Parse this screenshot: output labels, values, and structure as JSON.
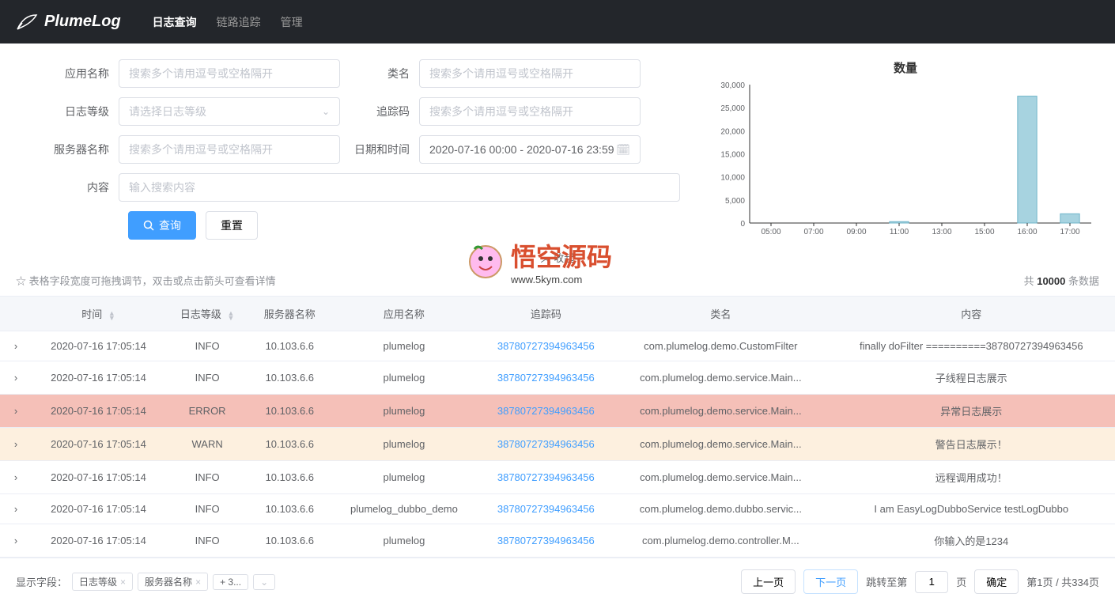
{
  "header": {
    "brand": "PlumeLog",
    "nav": [
      {
        "label": "日志查询",
        "active": true
      },
      {
        "label": "链路追踪",
        "active": false
      },
      {
        "label": "管理",
        "active": false
      }
    ]
  },
  "form": {
    "appName": {
      "label": "应用名称",
      "placeholder": "搜索多个请用逗号或空格隔开"
    },
    "className": {
      "label": "类名",
      "placeholder": "搜索多个请用逗号或空格隔开"
    },
    "logLevel": {
      "label": "日志等级",
      "placeholder": "请选择日志等级"
    },
    "traceId": {
      "label": "追踪码",
      "placeholder": "搜索多个请用逗号或空格隔开"
    },
    "serverName": {
      "label": "服务器名称",
      "placeholder": "搜索多个请用逗号或空格隔开"
    },
    "dateTime": {
      "label": "日期和时间",
      "value": "2020-07-16 00:00 - 2020-07-16 23:59"
    },
    "content": {
      "label": "内容",
      "placeholder": "输入搜索内容"
    },
    "searchBtn": "查询",
    "resetBtn": "重置"
  },
  "chart": {
    "title": "数量"
  },
  "chart_data": {
    "type": "bar",
    "title": "数量",
    "xlabel": "",
    "ylabel": "",
    "ylim": [
      0,
      30000
    ],
    "categories": [
      "05:00",
      "07:00",
      "09:00",
      "11:00",
      "13:00",
      "15:00",
      "16:00",
      "17:00"
    ],
    "values": [
      0,
      0,
      0,
      300,
      0,
      0,
      27500,
      2000
    ]
  },
  "collapse": "收起",
  "tip": "表格字段宽度可拖拽调节，双击或点击箭头可查看详情",
  "total": {
    "prefix": "共 ",
    "count": "10000",
    "suffix": " 条数据"
  },
  "columns": [
    "时间",
    "日志等级",
    "服务器名称",
    "应用名称",
    "追踪码",
    "类名",
    "内容"
  ],
  "rows": [
    {
      "time": "2020-07-16 17:05:14",
      "level": "INFO",
      "server": "10.103.6.6",
      "app": "plumelog",
      "trace": "38780727394963456",
      "class": "com.plumelog.demo.CustomFilter",
      "content": "finally doFilter ==========38780727394963456",
      "cls": ""
    },
    {
      "time": "2020-07-16 17:05:14",
      "level": "INFO",
      "server": "10.103.6.6",
      "app": "plumelog",
      "trace": "38780727394963456",
      "class": "com.plumelog.demo.service.Main...",
      "content": "子线程日志展示",
      "cls": ""
    },
    {
      "time": "2020-07-16 17:05:14",
      "level": "ERROR",
      "server": "10.103.6.6",
      "app": "plumelog",
      "trace": "38780727394963456",
      "class": "com.plumelog.demo.service.Main...",
      "content": "异常日志展示",
      "cls": "error"
    },
    {
      "time": "2020-07-16 17:05:14",
      "level": "WARN",
      "server": "10.103.6.6",
      "app": "plumelog",
      "trace": "38780727394963456",
      "class": "com.plumelog.demo.service.Main...",
      "content": "警告日志展示！",
      "cls": "warn"
    },
    {
      "time": "2020-07-16 17:05:14",
      "level": "INFO",
      "server": "10.103.6.6",
      "app": "plumelog",
      "trace": "38780727394963456",
      "class": "com.plumelog.demo.service.Main...",
      "content": "远程调用成功！",
      "cls": ""
    },
    {
      "time": "2020-07-16 17:05:14",
      "level": "INFO",
      "server": "10.103.6.6",
      "app": "plumelog_dubbo_demo",
      "trace": "38780727394963456",
      "class": "com.plumelog.demo.dubbo.servic...",
      "content": "I am EasyLogDubboService testLogDubbo",
      "cls": ""
    },
    {
      "time": "2020-07-16 17:05:14",
      "level": "INFO",
      "server": "10.103.6.6",
      "app": "plumelog",
      "trace": "38780727394963456",
      "class": "com.plumelog.demo.controller.M...",
      "content": "你输入的是1234",
      "cls": ""
    }
  ],
  "footer": {
    "fieldsLabel": "显示字段：",
    "tags": [
      "日志等级",
      "服务器名称"
    ],
    "moreTag": "+ 3...",
    "prev": "上一页",
    "next": "下一页",
    "jumpLabel": "跳转至第",
    "pageUnit": "页",
    "confirm": "确定",
    "pageInfo": "第1页 / 共334页",
    "currentPage": "1"
  },
  "watermark": {
    "title": "悟空源码",
    "url": "www.5kym.com"
  }
}
